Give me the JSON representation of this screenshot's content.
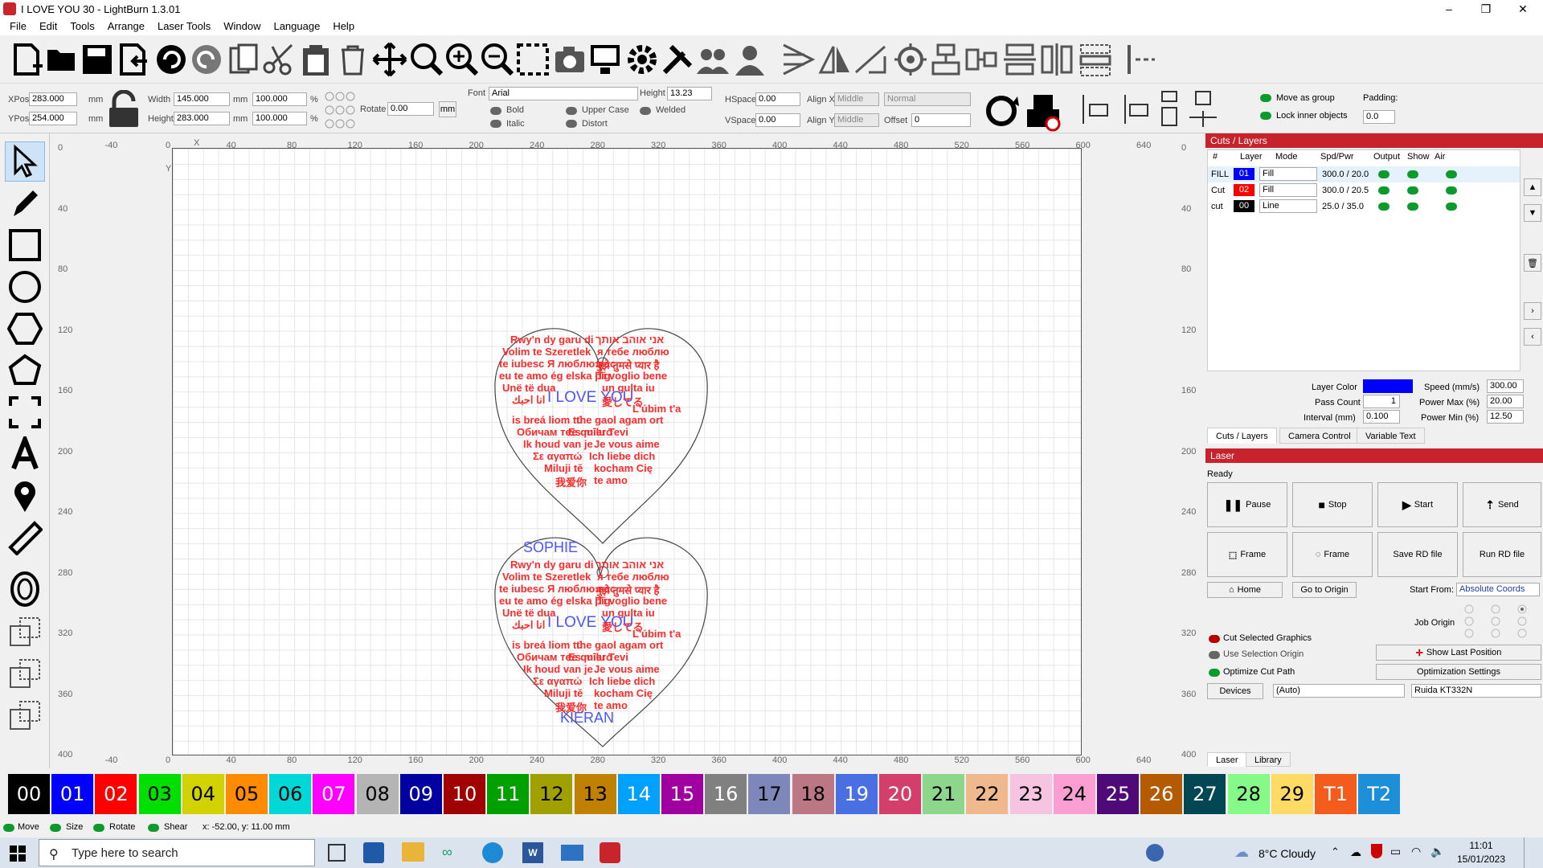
{
  "window": {
    "title": "I LOVE YOU  30 - LightBurn 1.3.01",
    "controls": [
      "–",
      "❐",
      "✕"
    ]
  },
  "menu": [
    "File",
    "Edit",
    "Tools",
    "Arrange",
    "Laser Tools",
    "Window",
    "Language",
    "Help"
  ],
  "toolbar_icons": [
    "new-file-icon",
    "open-folder-icon",
    "save-icon",
    "import-icon",
    "undo-icon",
    "redo-icon",
    "copy-icon",
    "cut-icon",
    "paste-icon",
    "delete-icon",
    "move-icon",
    "zoom-selection-icon",
    "zoom-in-icon",
    "zoom-out-icon",
    "zoom-frame-icon",
    "camera-icon",
    "monitor-icon",
    "settings-icon",
    "tools-icon",
    "group-icon",
    "user-icon",
    "flip-horizontal-icon",
    "mirror-icon",
    "rotate-icon",
    "target-icon",
    "align-left-icon",
    "align-center-icon",
    "align-top-icon",
    "align-middle-icon",
    "distribute-icon",
    "align-right-icon"
  ],
  "props": {
    "xpos_label": "XPos",
    "xpos": "283.000",
    "ypos_label": "YPos",
    "ypos": "254.000",
    "unit": "mm",
    "width_label": "Width",
    "width": "145.000",
    "height_label": "Height",
    "height": "283.000",
    "scale_w": "100.000",
    "scale_h": "100.000",
    "pct": "%",
    "rotate_label": "Rotate",
    "rotate": "0.00",
    "mm_btn": "mm",
    "font_label": "Font",
    "font": "Arial",
    "fheight_label": "Height",
    "fheight": "13.23",
    "hspace_label": "HSpace",
    "hspace": "0.00",
    "vspace_label": "VSpace",
    "vspace": "0.00",
    "alignx_label": "Align X",
    "alignx": "Middle",
    "aligny_label": "Align Y",
    "aligny": "Middle",
    "normal": "Normal",
    "offset_label": "Offset",
    "offset": "0",
    "bold": "Bold",
    "italic": "Italic",
    "upper": "Upper Case",
    "distort": "Distort",
    "welded": "Welded",
    "move_group": "Move as group",
    "lock_inner": "Lock inner objects",
    "padding_label": "Padding:",
    "padding": "0.0"
  },
  "rulers": {
    "top": [
      "-40",
      "0",
      "40",
      "80",
      "120",
      "160",
      "200",
      "240",
      "280",
      "320",
      "360",
      "400",
      "440",
      "480",
      "520",
      "560",
      "600",
      "640"
    ],
    "bottom": [
      "-40",
      "0",
      "40",
      "80",
      "120",
      "160",
      "200",
      "240",
      "280",
      "320",
      "360",
      "400",
      "440",
      "480",
      "520",
      "560",
      "600",
      "640"
    ],
    "left": [
      "0",
      "40",
      "80",
      "120",
      "160",
      "200",
      "240",
      "280",
      "320",
      "360",
      "400"
    ],
    "right": [
      "0",
      "40",
      "80",
      "120",
      "160",
      "200",
      "240",
      "280",
      "320",
      "360",
      "400"
    ],
    "x_mark": "X",
    "y_mark": "Y"
  },
  "design": {
    "heart1": {
      "red_lines": [
        "Rwy'n dy garu di",
        "אני אוהב אותך",
        "Volim te Szeretlek",
        "я тебе люблю",
        "te iubesc Я люблю вас",
        "मुझे तुमसे प्यार है",
        "eu te amo ég elska þig",
        "Ti voglio bene",
        "Unë të dua",
        "un gulta iu",
        "انا احبك",
        "愛してる",
        "is breá liom tú",
        "L'úbim t'a",
        "Обичам те",
        "the gaol agam ort",
        "Es mīlu Tevi",
        "te quiero",
        "Ik houd van je",
        "Je vous aime",
        "Σε αγαπώ",
        "Ich liebe dich",
        "Miluji tě",
        "kocham Cię",
        "我爱你",
        "te amo"
      ],
      "blue": "I LOVE YOU"
    },
    "heart2": {
      "top_name": "SOPHIE",
      "red_lines": [
        "Rwy'n dy garu di",
        "אני אוהב אותך",
        "Volim te Szeretlek",
        "я тебе люблю",
        "te iubesc Я люблю вас",
        "मुझे तुमसे प्यार है",
        "eu te amo ég elska þig",
        "Ti voglio bene",
        "Unë të dua",
        "un gulta iu",
        "انا احبك",
        "愛してる",
        "is breá liom tú",
        "L'úbim t'a",
        "Обичам те",
        "the gaol agam ort",
        "Es mīlu Tevi",
        "te quiero",
        "Ik houd van je",
        "Je vous aime",
        "Σε αγαπώ",
        "Ich liebe dich",
        "Miluji tě",
        "kocham Cię",
        "我爱你",
        "te amo"
      ],
      "blue": "I LOVE YOU",
      "bottom_name": "KIERAN"
    }
  },
  "cuts": {
    "header": "Cuts / Layers",
    "cols": [
      "#",
      "Layer",
      "Mode",
      "Spd/Pwr",
      "Output",
      "Show",
      "Air"
    ],
    "rows": [
      {
        "name": "FILL",
        "layer": "01",
        "color": "#0000ff",
        "mode": "Fill",
        "spd": "300.0 / 20.0"
      },
      {
        "name": "Cut",
        "layer": "02",
        "color": "#ff0000",
        "mode": "Fill",
        "spd": "300.0 / 20.5"
      },
      {
        "name": "cut",
        "layer": "00",
        "color": "#000000",
        "mode": "Line",
        "spd": "25.0 / 35.0"
      }
    ],
    "layer_color_label": "Layer Color",
    "speed_label": "Speed (mm/s)",
    "speed": "300.00",
    "pass_label": "Pass Count",
    "pass": "1",
    "pmax_label": "Power Max (%)",
    "pmax": "20.00",
    "interval_label": "Interval (mm)",
    "interval": "0.100",
    "pmin_label": "Power Min (%)",
    "pmin": "12.50",
    "tabs": [
      "Cuts / Layers",
      "Camera Control",
      "Variable Text"
    ]
  },
  "laser": {
    "header": "Laser",
    "status": "Ready",
    "pause": "Pause",
    "stop": "Stop",
    "start": "Start",
    "send": "Send",
    "frame1": "Frame",
    "frame2": "Frame",
    "save_rd": "Save RD file",
    "run_rd": "Run RD file",
    "home": "Home",
    "go_origin": "Go to Origin",
    "start_from_label": "Start From:",
    "start_from": "Absolute Coords",
    "job_origin": "Job Origin",
    "cut_selected": "Cut Selected Graphics",
    "use_selection": "Use Selection Origin",
    "optimize": "Optimize Cut Path",
    "show_last": "Show Last Position",
    "opt_settings": "Optimization Settings",
    "devices": "Devices",
    "auto": "(Auto)",
    "device": "Ruida KT332N",
    "tabs": [
      "Laser",
      "Library"
    ]
  },
  "palette": [
    {
      "l": "00",
      "c": "#000000",
      "t": "#ffffff"
    },
    {
      "l": "01",
      "c": "#0000ff",
      "t": "#ffffff"
    },
    {
      "l": "02",
      "c": "#ff0000",
      "t": "#ffffff"
    },
    {
      "l": "03",
      "c": "#00e000",
      "t": "#000000"
    },
    {
      "l": "04",
      "c": "#d2d200",
      "t": "#000000"
    },
    {
      "l": "05",
      "c": "#ff8c00",
      "t": "#000000"
    },
    {
      "l": "06",
      "c": "#00d8d8",
      "t": "#000000"
    },
    {
      "l": "07",
      "c": "#ff00ff",
      "t": "#ffffff"
    },
    {
      "l": "08",
      "c": "#b4b4b4",
      "t": "#000000"
    },
    {
      "l": "09",
      "c": "#0000a0",
      "t": "#ffffff"
    },
    {
      "l": "10",
      "c": "#a00000",
      "t": "#ffffff"
    },
    {
      "l": "11",
      "c": "#00a000",
      "t": "#ffffff"
    },
    {
      "l": "12",
      "c": "#a0a000",
      "t": "#000000"
    },
    {
      "l": "13",
      "c": "#c08000",
      "t": "#000000"
    },
    {
      "l": "14",
      "c": "#00a0ff",
      "t": "#ffffff"
    },
    {
      "l": "15",
      "c": "#a000a0",
      "t": "#ffffff"
    },
    {
      "l": "16",
      "c": "#808080",
      "t": "#ffffff"
    },
    {
      "l": "17",
      "c": "#7d87b9",
      "t": "#000000"
    },
    {
      "l": "18",
      "c": "#bb7784",
      "t": "#000000"
    },
    {
      "l": "19",
      "c": "#4a6fe3",
      "t": "#ffffff"
    },
    {
      "l": "20",
      "c": "#d33f6a",
      "t": "#ffffff"
    },
    {
      "l": "21",
      "c": "#8cd78c",
      "t": "#000000"
    },
    {
      "l": "22",
      "c": "#f0b98d",
      "t": "#000000"
    },
    {
      "l": "23",
      "c": "#f6c4e1",
      "t": "#000000"
    },
    {
      "l": "24",
      "c": "#fa9ed4",
      "t": "#000000"
    },
    {
      "l": "25",
      "c": "#500a78",
      "t": "#ffffff"
    },
    {
      "l": "26",
      "c": "#b45a00",
      "t": "#ffffff"
    },
    {
      "l": "27",
      "c": "#004754",
      "t": "#ffffff"
    },
    {
      "l": "28",
      "c": "#86fa88",
      "t": "#000000"
    },
    {
      "l": "29",
      "c": "#ffdb66",
      "t": "#000000"
    },
    {
      "l": "T1",
      "c": "#f35c1c",
      "t": "#ffffff"
    },
    {
      "l": "T2",
      "c": "#1c8fd8",
      "t": "#ffffff"
    }
  ],
  "status": {
    "move": "Move",
    "size": "Size",
    "rotate": "Rotate",
    "shear": "Shear",
    "coords": "x: -52.00, y: 11.00 mm"
  },
  "taskbar": {
    "search": "Type here to search",
    "weather": "8°C  Cloudy",
    "time": "11:01",
    "date": "15/01/2023"
  }
}
